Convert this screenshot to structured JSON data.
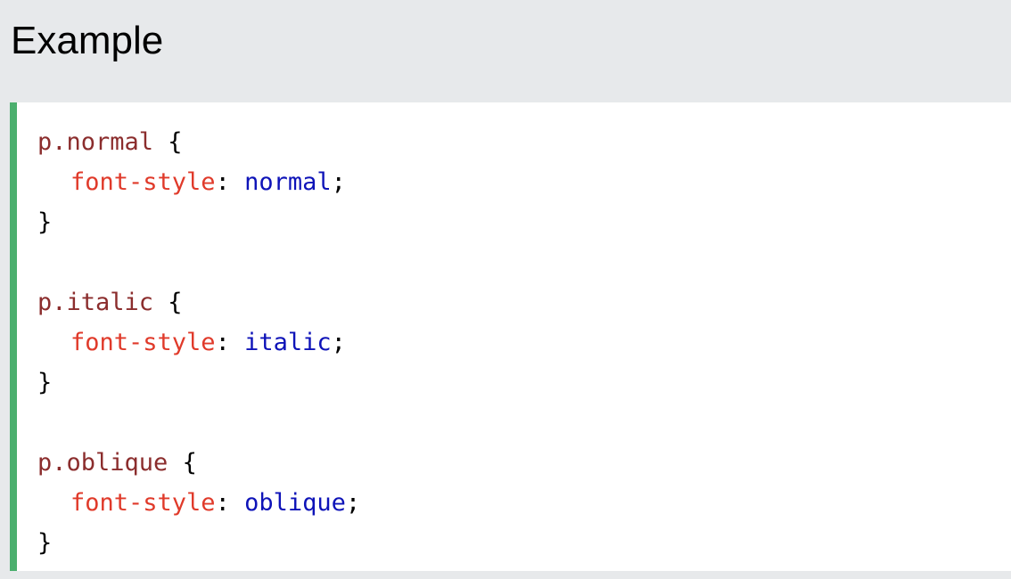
{
  "heading": "Example",
  "colors": {
    "background": "#e7e9eb",
    "code_background": "#ffffff",
    "accent_border": "#4caf6e",
    "selector": "#8b2d2d",
    "property": "#e03a2a",
    "value": "#0e13b8",
    "punctuation": "#000000"
  },
  "code": {
    "rules": [
      {
        "selector": "p.normal",
        "open_brace": " {",
        "property": "font-style",
        "colon": ": ",
        "value": "normal",
        "semicolon": ";",
        "close_brace": "}"
      },
      {
        "selector": "p.italic",
        "open_brace": " {",
        "property": "font-style",
        "colon": ": ",
        "value": "italic",
        "semicolon": ";",
        "close_brace": "}"
      },
      {
        "selector": "p.oblique",
        "open_brace": " {",
        "property": "font-style",
        "colon": ": ",
        "value": "oblique",
        "semicolon": ";",
        "close_brace": "}"
      }
    ]
  }
}
